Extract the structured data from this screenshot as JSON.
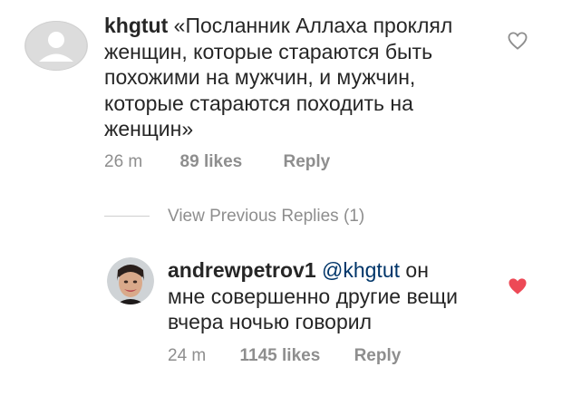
{
  "comment1": {
    "username": "khgtut",
    "text_line1": "«Посланник Аллаха проклял",
    "text_line2": "женщин, которые стараются быть",
    "text_line3": "похожими на мужчин, и мужчин,",
    "text_line4": "которые стараются походить на",
    "text_line5": "женщин»",
    "time": "26 m",
    "likes": "89 likes",
    "reply": "Reply",
    "liked": false
  },
  "view_replies": "View Previous Replies (1)",
  "comment2": {
    "username": "andrewpetrov1",
    "mention": "@khgtut",
    "text_line1_rest": "он",
    "text_line2": "мне совершенно другие вещи",
    "text_line3": "вчера ночью говорил",
    "time": "24 m",
    "likes": "1145 likes",
    "reply": "Reply",
    "liked": true
  },
  "colors": {
    "heart_liked": "#ed4956",
    "heart_outline": "#8e8e8e",
    "mention": "#003569"
  },
  "icons": {
    "like_empty": "heart-outline-icon",
    "like_filled": "heart-filled-icon",
    "avatar_placeholder": "default-avatar"
  }
}
